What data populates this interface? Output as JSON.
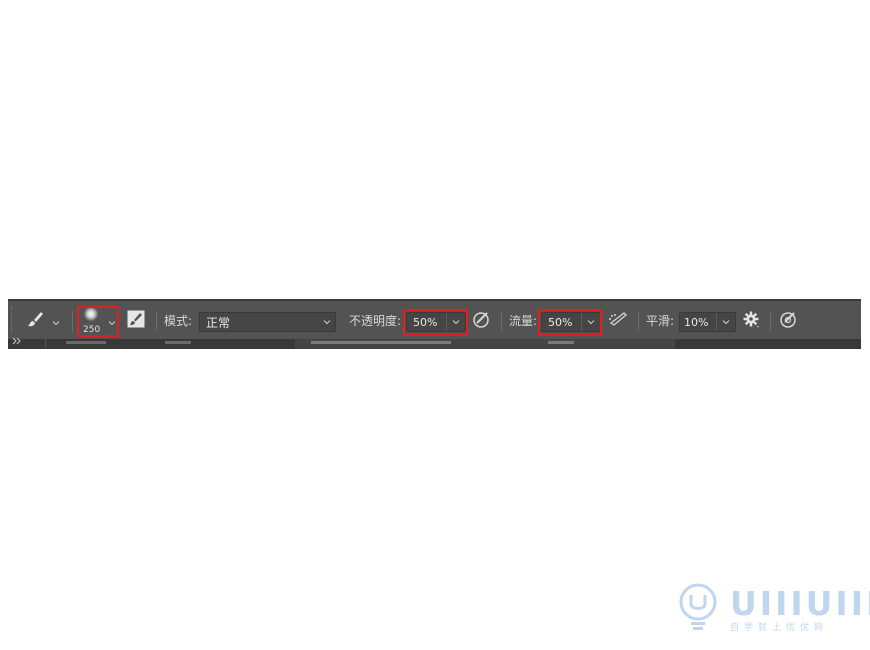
{
  "toolbar": {
    "brush_size": "250",
    "mode_label": "模式:",
    "mode_value": "正常",
    "opacity_label": "不透明度:",
    "opacity_value": "50%",
    "flow_label": "流量:",
    "flow_value": "50%",
    "smoothing_label": "平滑:",
    "smoothing_value": "10%",
    "icons": {
      "tool": "brush-icon",
      "preset": "brush-preset-icon",
      "panel": "brush-settings-panel-icon",
      "opacity_pressure": "pressure-opacity-icon",
      "airbrush": "airbrush-icon",
      "settings": "gear-icon",
      "size_pressure": "pressure-size-icon"
    }
  },
  "highlight_color": "#e02020",
  "watermark": {
    "name": "UIIIUIII",
    "tagline": "自学就上优优网",
    "color": "#bfd6ee"
  }
}
